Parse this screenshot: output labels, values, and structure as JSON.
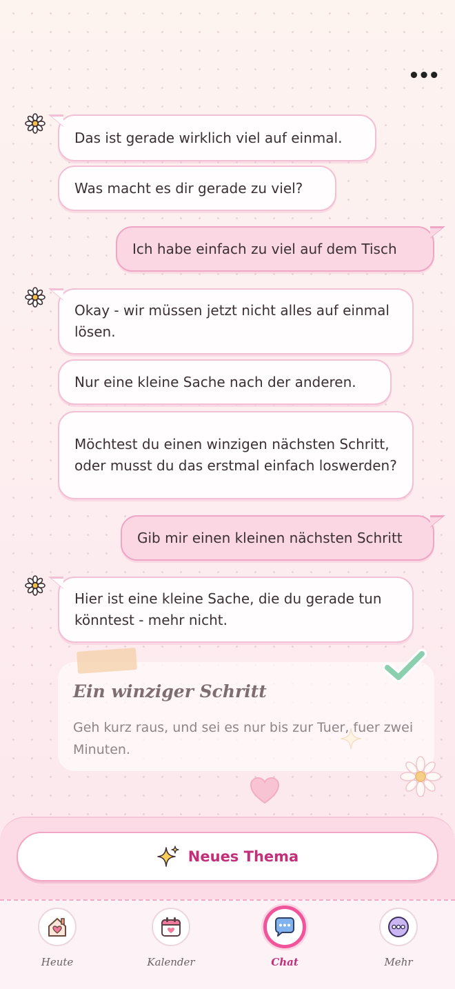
{
  "header": {
    "more_label": "•••"
  },
  "messages": [
    {
      "from": "bot",
      "text": "Das ist gerade wirklich viel auf einmal."
    },
    {
      "from": "bot",
      "text": "Was macht es dir gerade zu viel?"
    },
    {
      "from": "user",
      "text": "Ich habe einfach zu viel auf dem Tisch"
    },
    {
      "from": "bot",
      "text": "Okay - wir müssen jetzt nicht alles auf einmal lösen."
    },
    {
      "from": "bot",
      "text": "Nur eine kleine Sache nach der anderen."
    },
    {
      "from": "bot",
      "text": "Möchtest du einen winzigen nächsten Schritt, oder musst du das erstmal einfach loswerden?"
    },
    {
      "from": "user",
      "text": "Gib mir einen kleinen nächsten Schritt"
    },
    {
      "from": "bot",
      "text": "Hier ist eine kleine Sache, die du gerade tun könntest - mehr nicht."
    }
  ],
  "step_card": {
    "title": "Ein winziger Schritt",
    "text": "Geh kurz raus, und sei es nur bis zur Tuer, fuer zwei Minuten."
  },
  "new_topic": {
    "label": "Neues Thema"
  },
  "nav": {
    "items": [
      {
        "label": "Heute",
        "icon": "home-icon"
      },
      {
        "label": "Kalender",
        "icon": "calendar-icon"
      },
      {
        "label": "Chat",
        "icon": "chat-icon",
        "active": true
      },
      {
        "label": "Mehr",
        "icon": "more-icon"
      }
    ]
  },
  "colors": {
    "accent": "#f0549a",
    "accent_text": "#c2307a",
    "user_bubble": "#fbd7e4",
    "bot_bubble": "#fffdfd"
  }
}
